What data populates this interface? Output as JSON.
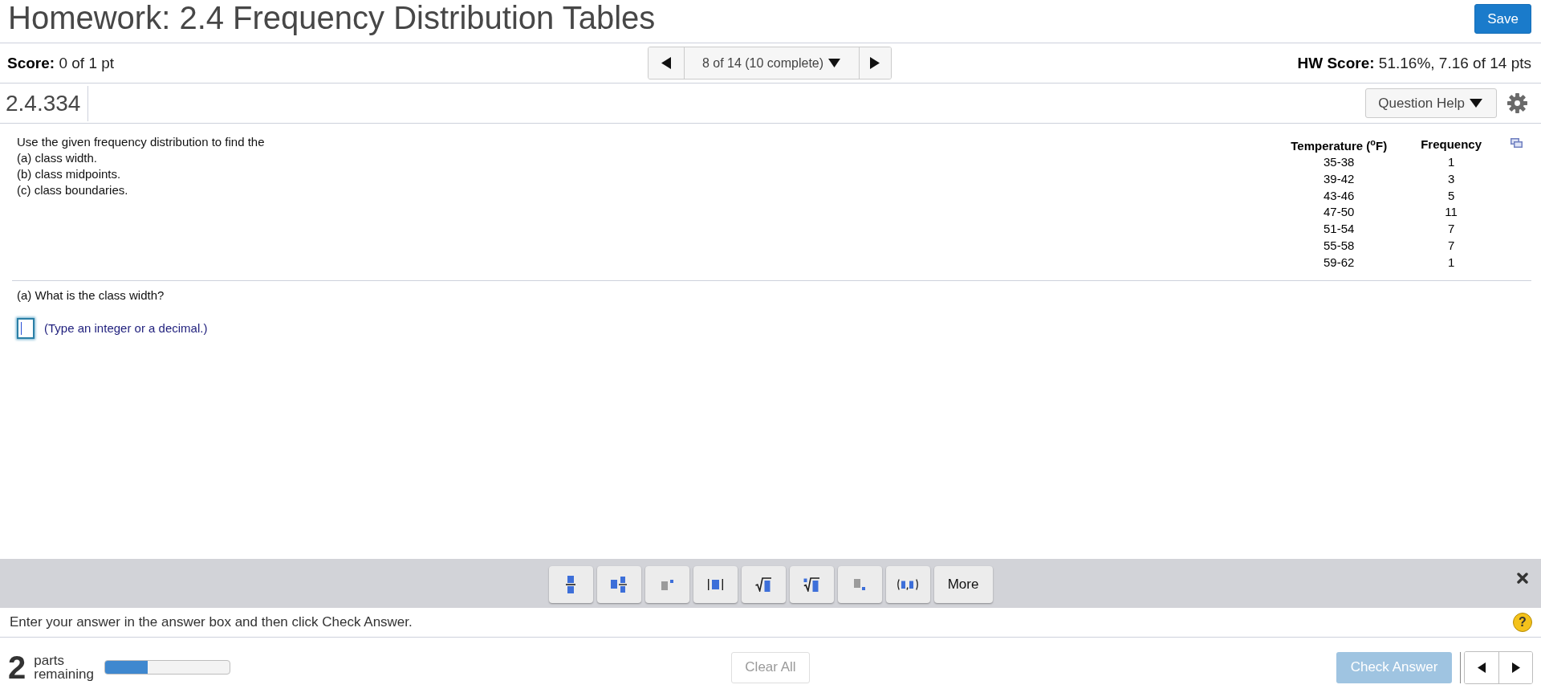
{
  "header": {
    "title": "Homework: 2.4 Frequency Distribution Tables",
    "save": "Save"
  },
  "score_bar": {
    "score": {
      "label": "Score:",
      "value": "0 of 1 pt"
    },
    "navigator": {
      "position": "8 of 14 (10 complete)"
    },
    "hw_score": {
      "label": "HW Score:",
      "value": "51.16%, 7.16 of 14 pts"
    }
  },
  "question_bar": {
    "number": "2.4.334",
    "help_button": "Question Help"
  },
  "question": {
    "prompt": [
      "Use the given frequency distribution to find the",
      "(a) class width.",
      "(b) class midpoints.",
      "(c) class boundaries."
    ],
    "table": {
      "columns": [
        "Temperature ($^{o}$F)",
        "Frequency"
      ],
      "rows": [
        [
          "35-38",
          "1"
        ],
        [
          "39-42",
          "3"
        ],
        [
          "43-46",
          "5"
        ],
        [
          "47-50",
          "11"
        ],
        [
          "51-54",
          "7"
        ],
        [
          "55-58",
          "7"
        ],
        [
          "59-62",
          "1"
        ]
      ]
    },
    "part": "(a) What is the class width?",
    "answer": {
      "focused": true,
      "hint": "(Type an integer or a decimal.)"
    }
  },
  "math_toolbar": {
    "buttons": [
      {
        "kind": "fraction"
      },
      {
        "kind": "mixed"
      },
      {
        "kind": "exponent"
      },
      {
        "kind": "absolute"
      },
      {
        "kind": "sqrt"
      },
      {
        "kind": "root"
      },
      {
        "kind": "subscript"
      },
      {
        "kind": "pair"
      },
      {
        "kind": "more",
        "label": "More"
      }
    ]
  },
  "instruction": "Enter your answer in the answer box and then click Check Answer.",
  "help": "?",
  "footer": {
    "parts_count": "2",
    "parts_label": "parts remaining",
    "progress": {
      "level": 0.34
    },
    "clear_all": {
      "label": "Clear All",
      "disabled": true
    },
    "check_answer": {
      "label": "Check Answer",
      "disabled": true
    }
  }
}
